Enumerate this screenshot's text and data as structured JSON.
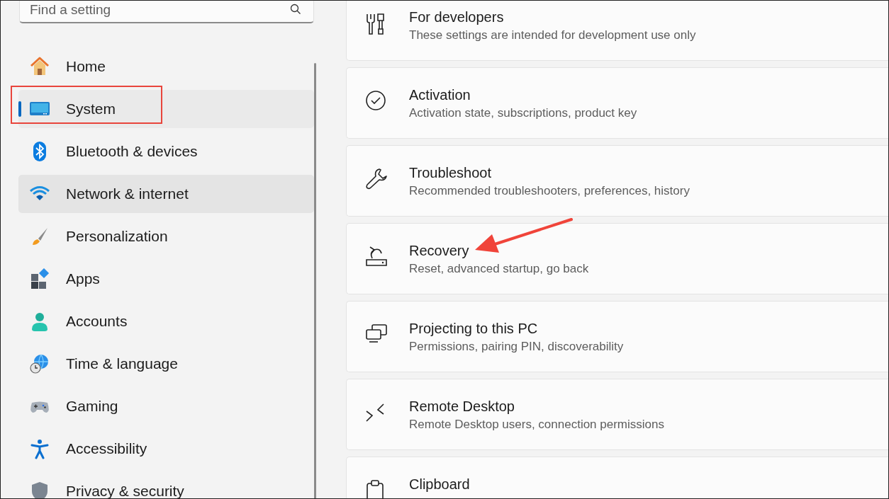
{
  "search": {
    "placeholder": "Find a setting"
  },
  "nav": [
    {
      "label": "Home",
      "selected": false,
      "hovered": false,
      "annotated": false
    },
    {
      "label": "System",
      "selected": true,
      "hovered": false,
      "annotated": true
    },
    {
      "label": "Bluetooth & devices",
      "selected": false,
      "hovered": false,
      "annotated": false
    },
    {
      "label": "Network & internet",
      "selected": false,
      "hovered": true,
      "annotated": false
    },
    {
      "label": "Personalization",
      "selected": false,
      "hovered": false,
      "annotated": false
    },
    {
      "label": "Apps",
      "selected": false,
      "hovered": false,
      "annotated": false
    },
    {
      "label": "Accounts",
      "selected": false,
      "hovered": false,
      "annotated": false
    },
    {
      "label": "Time & language",
      "selected": false,
      "hovered": false,
      "annotated": false
    },
    {
      "label": "Gaming",
      "selected": false,
      "hovered": false,
      "annotated": false
    },
    {
      "label": "Accessibility",
      "selected": false,
      "hovered": false,
      "annotated": false
    },
    {
      "label": "Privacy & security",
      "selected": false,
      "hovered": false,
      "annotated": false
    }
  ],
  "cards": [
    {
      "title": "For developers",
      "subtitle": "These settings are intended for development use only",
      "annotated": false
    },
    {
      "title": "Activation",
      "subtitle": "Activation state, subscriptions, product key",
      "annotated": false
    },
    {
      "title": "Troubleshoot",
      "subtitle": "Recommended troubleshooters, preferences, history",
      "annotated": false
    },
    {
      "title": "Recovery",
      "subtitle": "Reset, advanced startup, go back",
      "annotated": true
    },
    {
      "title": "Projecting to this PC",
      "subtitle": "Permissions, pairing PIN, discoverability",
      "annotated": false
    },
    {
      "title": "Remote Desktop",
      "subtitle": "Remote Desktop users, connection permissions",
      "annotated": false
    },
    {
      "title": "Clipboard",
      "annotated": false
    }
  ]
}
